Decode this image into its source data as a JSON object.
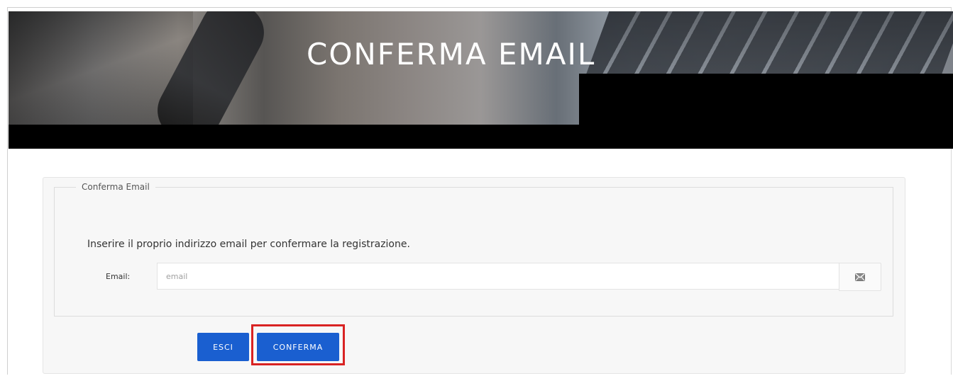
{
  "banner": {
    "title": "CONFERMA EMAIL"
  },
  "form": {
    "legend": "Conferma Email",
    "instructions": "Inserire il proprio indirizzo email per confermare la registrazione.",
    "email_label": "Email:",
    "email_placeholder": "email",
    "email_value": "",
    "email_addon_icon": "envelope-icon"
  },
  "actions": {
    "exit_label": "ESCI",
    "confirm_label": "CONFERMA"
  },
  "colors": {
    "primary_button": "#1a5fd0",
    "highlight": "#d92323",
    "banner_bg": "#000000"
  }
}
